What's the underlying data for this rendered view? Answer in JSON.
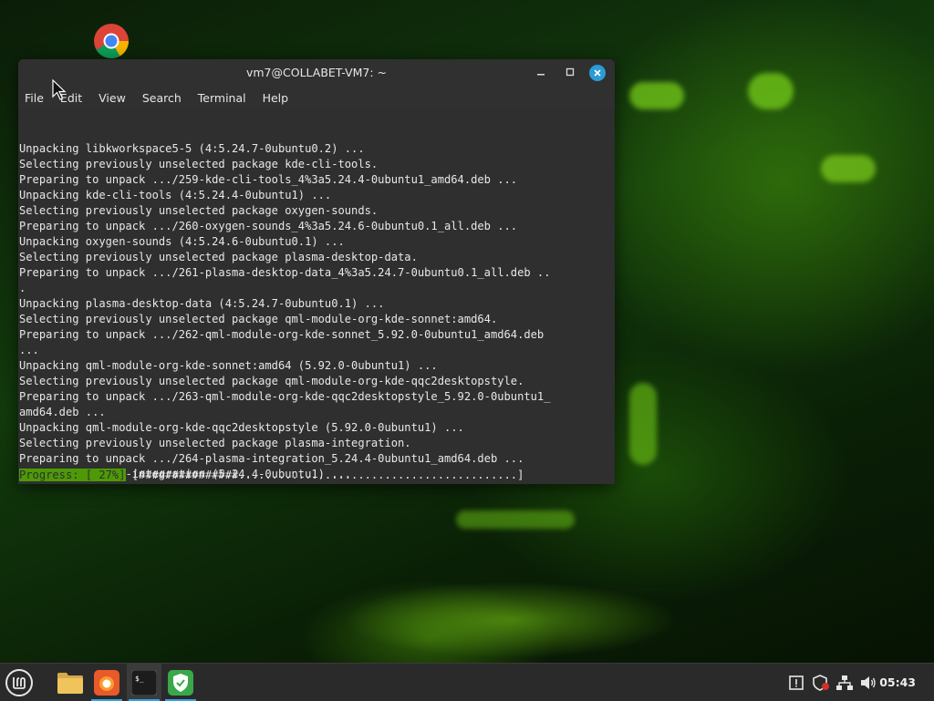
{
  "window": {
    "title": "vm7@COLLABET-VM7: ~",
    "menu": [
      "File",
      "Edit",
      "View",
      "Search",
      "Terminal",
      "Help"
    ]
  },
  "terminal": {
    "lines": [
      "Unpacking libkworkspace5-5 (4:5.24.7-0ubuntu0.2) ...",
      "Selecting previously unselected package kde-cli-tools.",
      "Preparing to unpack .../259-kde-cli-tools_4%3a5.24.4-0ubuntu1_amd64.deb ...",
      "Unpacking kde-cli-tools (4:5.24.4-0ubuntu1) ...",
      "Selecting previously unselected package oxygen-sounds.",
      "Preparing to unpack .../260-oxygen-sounds_4%3a5.24.6-0ubuntu0.1_all.deb ...",
      "Unpacking oxygen-sounds (4:5.24.6-0ubuntu0.1) ...",
      "Selecting previously unselected package plasma-desktop-data.",
      "Preparing to unpack .../261-plasma-desktop-data_4%3a5.24.7-0ubuntu0.1_all.deb ..",
      ".",
      "Unpacking plasma-desktop-data (4:5.24.7-0ubuntu0.1) ...",
      "Selecting previously unselected package qml-module-org-kde-sonnet:amd64.",
      "Preparing to unpack .../262-qml-module-org-kde-sonnet_5.92.0-0ubuntu1_amd64.deb",
      "...",
      "Unpacking qml-module-org-kde-sonnet:amd64 (5.92.0-0ubuntu1) ...",
      "Selecting previously unselected package qml-module-org-kde-qqc2desktopstyle.",
      "Preparing to unpack .../263-qml-module-org-kde-qqc2desktopstyle_5.92.0-0ubuntu1_",
      "amd64.deb ...",
      "Unpacking qml-module-org-kde-qqc2desktopstyle (5.92.0-0ubuntu1) ...",
      "Selecting previously unselected package plasma-integration.",
      "Preparing to unpack .../264-plasma-integration_5.24.4-0ubuntu1_amd64.deb ...",
      "Unpacking plasma-integration (5.24.4-0ubuntu1) ..."
    ],
    "progress_label": "Progress: [ 27%]",
    "progress_bar": " [###############..........................................]",
    "progress_percent": 27
  },
  "taskbar": {
    "clock": "05:43",
    "apps": [
      "menu-icon",
      "files-icon",
      "firefox-icon",
      "terminal-icon",
      "shield-icon"
    ],
    "tray": [
      "notification-icon",
      "security-icon",
      "network-icon",
      "volume-icon"
    ]
  },
  "desktop": {
    "icons": [
      "chrome-icon"
    ]
  },
  "colors": {
    "accent": "#35a3e0",
    "progress": "#4e9a06",
    "terminal_bg": "#2f2f2f"
  }
}
